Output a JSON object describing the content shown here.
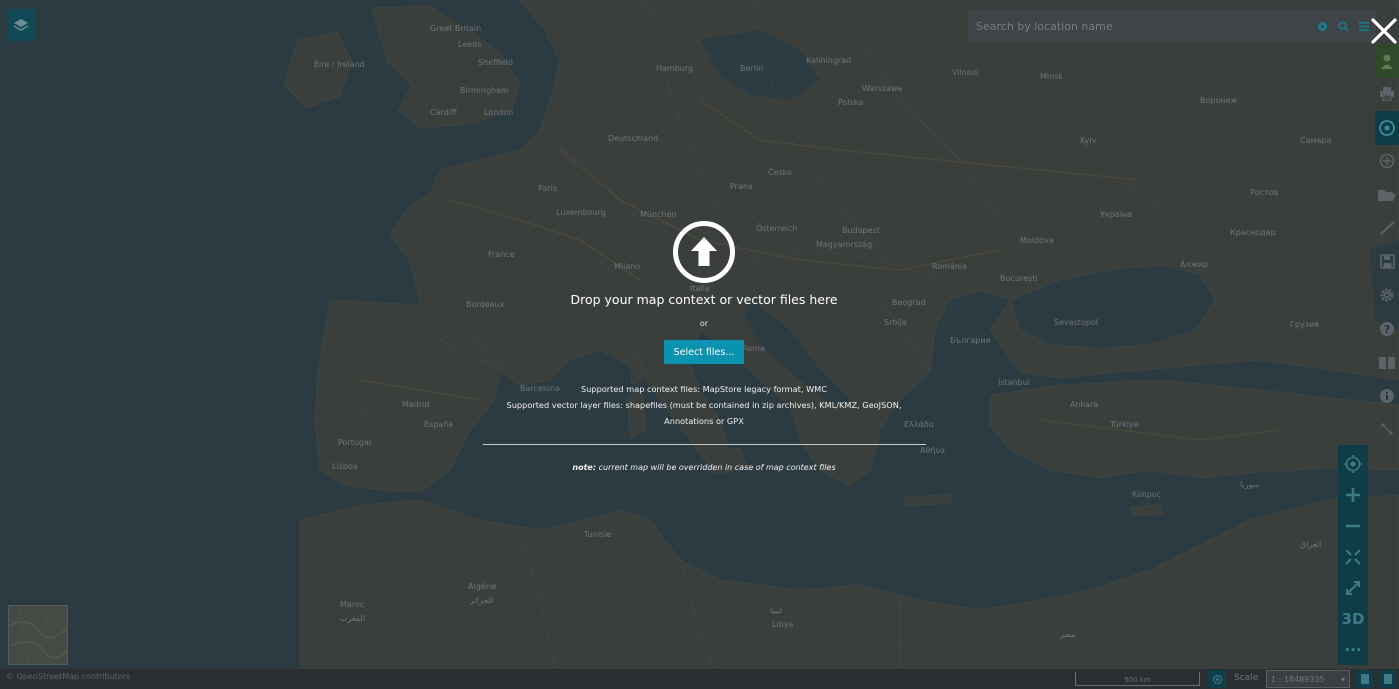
{
  "search": {
    "placeholder": "Search by location name"
  },
  "drop_zone": {
    "title": "Drop your map context or vector files here",
    "or": "or",
    "select_button": "Select files...",
    "supported_context": "Supported map context files: MapStore legacy format, WMC",
    "supported_vector_line1": "Supported vector layer files: shapefiles (must be contained in zip archives), KML/KMZ, GeoJSON,",
    "supported_vector_line2": "Annotations or GPX",
    "note_label": "note:",
    "note_text": " current map will be overridden in case of map context files"
  },
  "zoom_toolbar": {
    "three_d_label": "3D",
    "more_label": "···"
  },
  "footer": {
    "attribution": "© OpenStreetMap contributors",
    "scalebar_text": "500 km",
    "scale_label": "Scale",
    "scale_value": "1 : 18489335"
  },
  "map_labels": [
    "Great Britain",
    "Leeds",
    "Sheffield",
    "Éire / Ireland",
    "Birmingham",
    "Cardiff",
    "London",
    "Hamburg",
    "Berlin",
    "Polska",
    "Warszawa",
    "Kaliningrad",
    "Vilnius",
    "Minsk",
    "Deutschland",
    "Česko",
    "Praha",
    "Kyiv",
    "Україна",
    "Paris",
    "Luxembourg",
    "France",
    "München",
    "Österreich",
    "Magyarország",
    "Budapest",
    "România",
    "Bucureşti",
    "Moldova",
    "Bordeaux",
    "Milano",
    "Italia",
    "Roma",
    "Beograd",
    "Srbija",
    "България",
    "España",
    "Madrid",
    "Portugal",
    "Lisboa",
    "Barcelona",
    "Ελλάδα",
    "Αθήνα",
    "İstanbul",
    "Türkiye",
    "Ankara",
    "Κύπρος",
    "سوريا",
    "العراق",
    "Algérie",
    "الجزائر",
    "Tunisie",
    "Maroc",
    "المغرب",
    "ليبيا",
    "Libya",
    "مصر",
    "Алжир",
    "Краснодар",
    "Ростов",
    "Грузия",
    "Sevastopol",
    "Воронеж",
    "Самара"
  ]
}
